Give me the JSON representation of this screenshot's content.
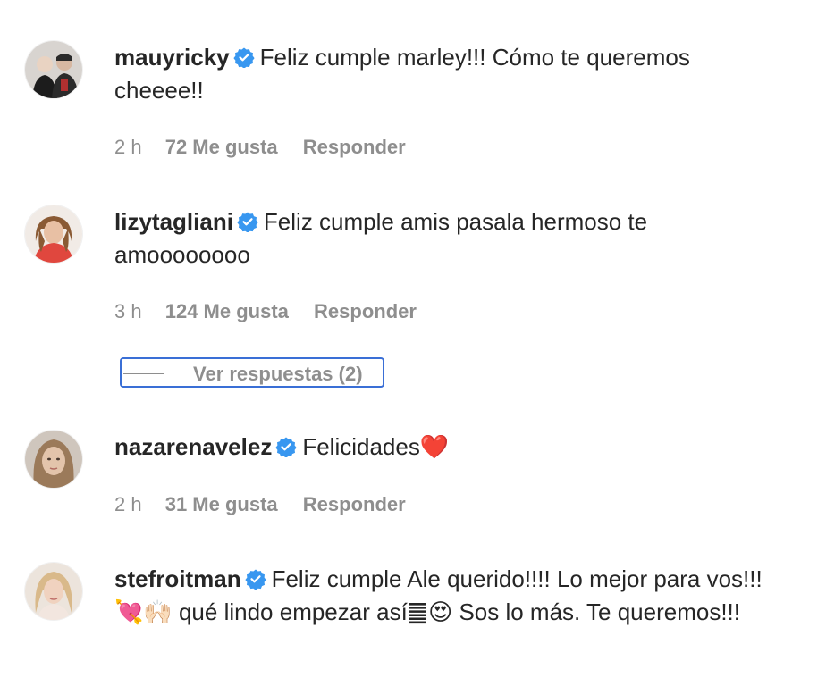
{
  "colors": {
    "text": "#262626",
    "muted": "#8e8e8e",
    "verified": "#3897f0",
    "focus": "#3a6fd6"
  },
  "verified_icon": "verified-badge-icon",
  "comments": [
    {
      "username": "mauyricky",
      "text": "Feliz cumple marley!!! Cómo te queremos cheeee!!",
      "time": "2 h",
      "likes": "72 Me gusta",
      "reply": "Responder"
    },
    {
      "username": "lizytagliani",
      "text": "Feliz cumple amis pasala hermoso te amoooooooo",
      "time": "3 h",
      "likes": "124 Me gusta",
      "reply": "Responder",
      "view_replies": "Ver respuestas (2)"
    },
    {
      "username": "nazarenavelez",
      "text": "Felicidades",
      "emoji": "❤️",
      "time": "2 h",
      "likes": "31 Me gusta",
      "reply": "Responder"
    },
    {
      "username": "stefroitman",
      "text_a": "Feliz cumple Ale querido!!!! Lo mejor para vos!!! ",
      "emoji_a": "💘🙌🏻",
      "text_b": " qué lindo empezar así",
      "emoji_b": "䷀😍",
      "text_c": " Sos lo más. Te queremos!!!"
    }
  ]
}
